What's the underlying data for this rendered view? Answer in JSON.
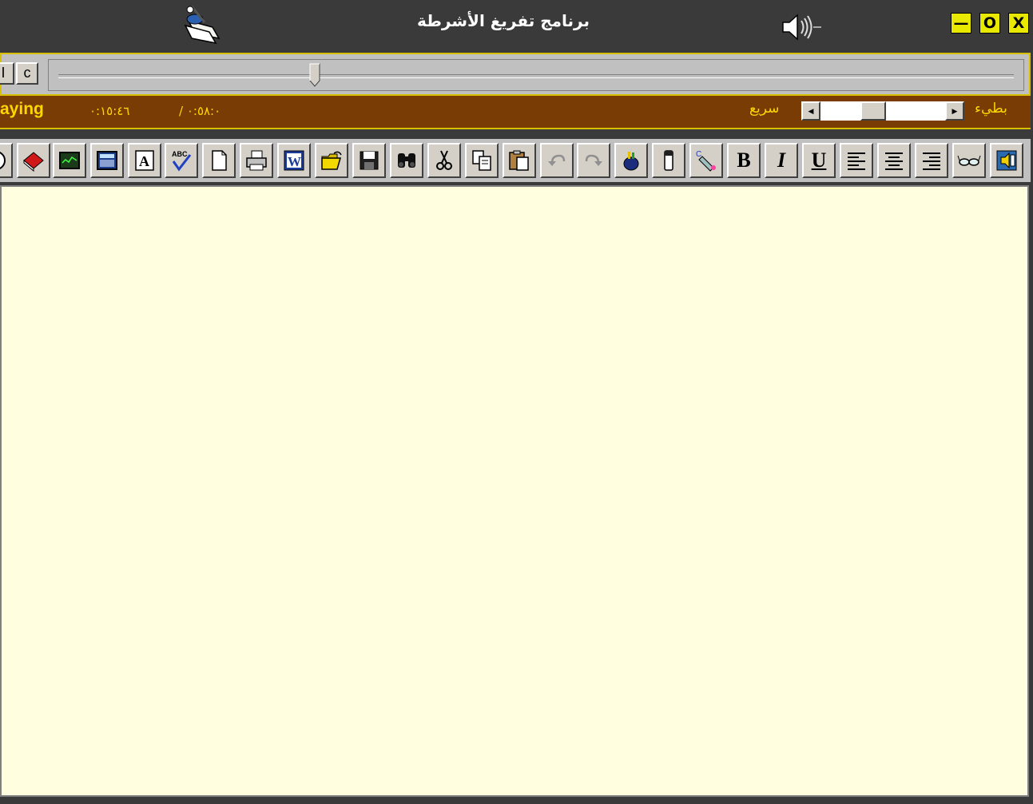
{
  "window": {
    "title": "برنامج تفريغ الأشرطة",
    "minimize_label": "—",
    "maximize_label": "O",
    "close_label": "X"
  },
  "player": {
    "btn_left_label": "I",
    "btn_c_label": "c",
    "seek_position": 0.27,
    "status": "aying",
    "current_time": "٠:١٥:٤٦",
    "total_time": "/ ٠:٥٨:٠",
    "speed_fast_label": "سريع",
    "speed_slow_label": "بطيء",
    "speed_value": 0.4
  },
  "toolbar": {
    "buttons": [
      {
        "name": "round-icon"
      },
      {
        "name": "book-icon"
      },
      {
        "name": "monitor-icon"
      },
      {
        "name": "calculator-icon"
      },
      {
        "name": "font-icon"
      },
      {
        "name": "spellcheck-icon"
      },
      {
        "name": "new-document-icon"
      },
      {
        "name": "print-icon"
      },
      {
        "name": "word-icon"
      },
      {
        "name": "open-folder-icon"
      },
      {
        "name": "save-icon"
      },
      {
        "name": "find-icon"
      },
      {
        "name": "cut-icon"
      },
      {
        "name": "copy-icon"
      },
      {
        "name": "paste-icon"
      },
      {
        "name": "undo-icon"
      },
      {
        "name": "redo-icon"
      },
      {
        "name": "color-pot-icon"
      },
      {
        "name": "pen-icon"
      },
      {
        "name": "spray-icon"
      },
      {
        "name": "bold-icon",
        "label": "B"
      },
      {
        "name": "italic-icon",
        "label": "I"
      },
      {
        "name": "underline-icon",
        "label": "U"
      },
      {
        "name": "align-left-icon"
      },
      {
        "name": "align-center-icon"
      },
      {
        "name": "align-right-icon"
      },
      {
        "name": "glasses-icon"
      },
      {
        "name": "audio-exit-icon"
      }
    ]
  },
  "editor": {
    "content": ""
  }
}
